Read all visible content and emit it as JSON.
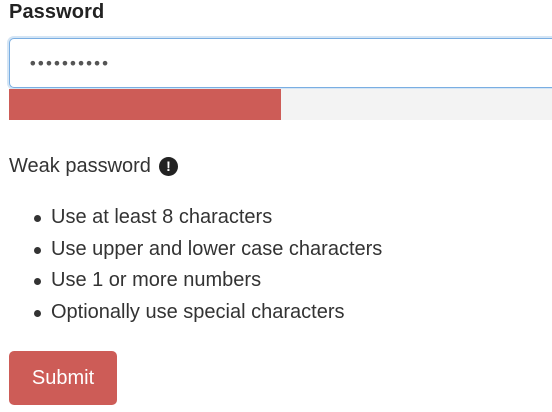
{
  "form": {
    "password_label": "Password",
    "password_value": "••••••••••",
    "submit_label": "Submit"
  },
  "strength": {
    "fraction": 0.5,
    "status": "Weak password",
    "status_icon": "exclamation-circle-icon",
    "color": "#cd5c57",
    "track_color": "#f3f3f3"
  },
  "requirements": [
    "Use at least 8 characters",
    "Use upper and lower case characters",
    "Use 1 or more numbers",
    "Optionally use special characters"
  ]
}
